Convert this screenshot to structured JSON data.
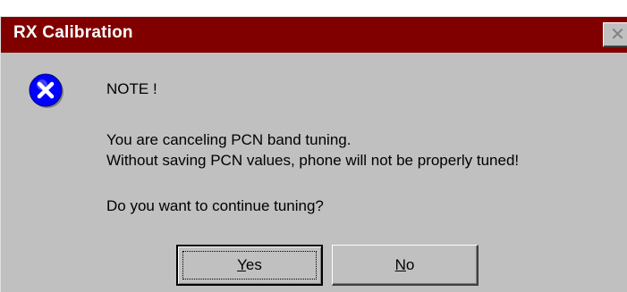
{
  "window": {
    "title": "RX Calibration",
    "close_glyph": "✕"
  },
  "message": {
    "icon": "error-icon",
    "heading": "NOTE !",
    "line1": "You are canceling PCN band tuning.",
    "line2": "Without saving PCN values, phone will not be properly tuned!",
    "question": "Do you want to continue tuning?"
  },
  "buttons": {
    "yes_mnemonic": "Y",
    "yes_rest": "es",
    "no_mnemonic": "N",
    "no_rest": "o"
  },
  "colors": {
    "titlebar": "#800000",
    "dialog_bg": "#c0c0c0",
    "icon_blue": "#0000ff"
  }
}
